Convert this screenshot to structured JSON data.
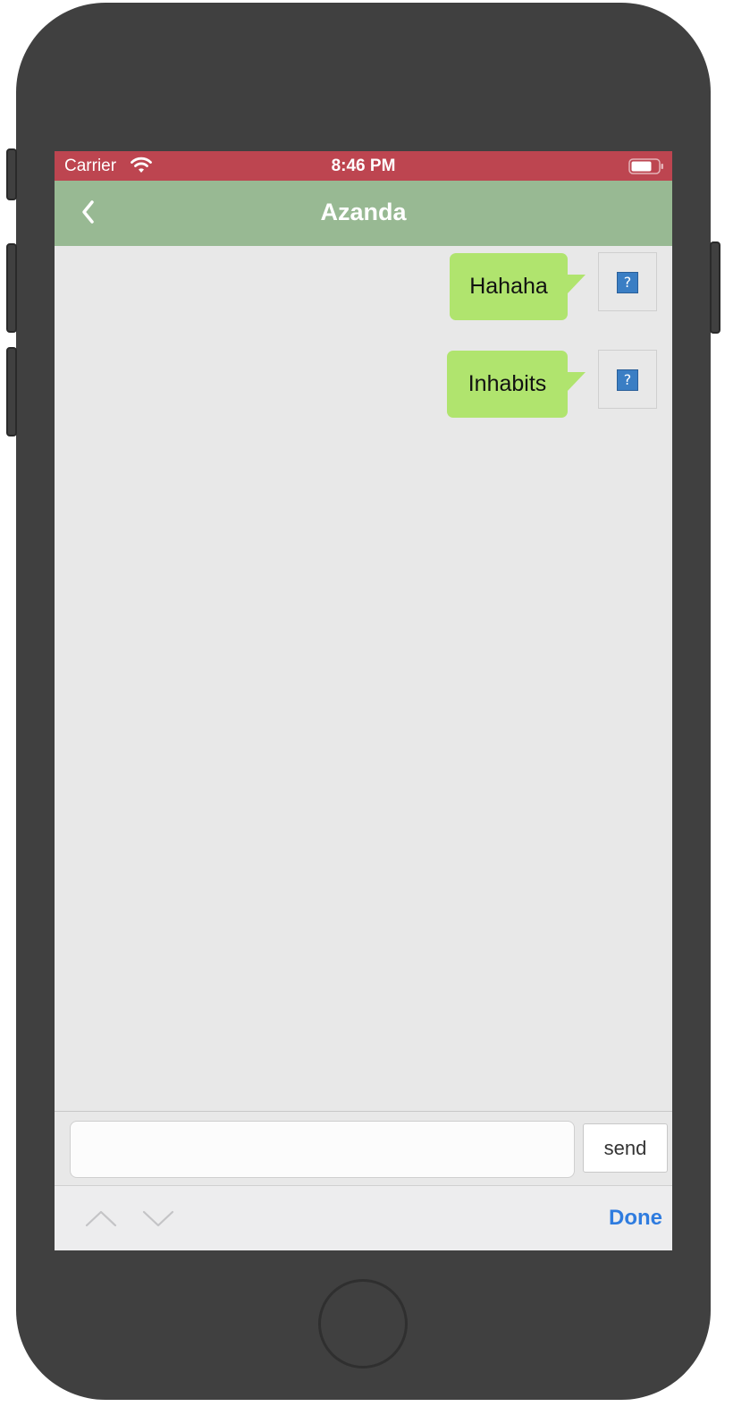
{
  "status_bar": {
    "carrier": "Carrier",
    "time": "8:46 PM",
    "wifi_icon": "wifi-icon",
    "battery_icon": "battery-icon",
    "background_color": "#bd4550"
  },
  "nav_bar": {
    "title": "Azanda",
    "back_icon": "chevron-left-icon",
    "background_color": "#98b993"
  },
  "messages": [
    {
      "text": "Hahaha",
      "sender": "self",
      "avatar_icon": "missing-image-icon",
      "avatar_glyph": "?"
    },
    {
      "text": "Inhabits",
      "sender": "self",
      "avatar_icon": "missing-image-icon",
      "avatar_glyph": "?"
    }
  ],
  "composer": {
    "input_value": "",
    "send_label": "send"
  },
  "accessory_bar": {
    "previous_icon": "chevron-up-icon",
    "next_icon": "chevron-down-icon",
    "done_label": "Done",
    "done_color": "#2f7cdf"
  },
  "colors": {
    "bubble": "#b0e46e",
    "chat_background": "#e8e8e8"
  }
}
